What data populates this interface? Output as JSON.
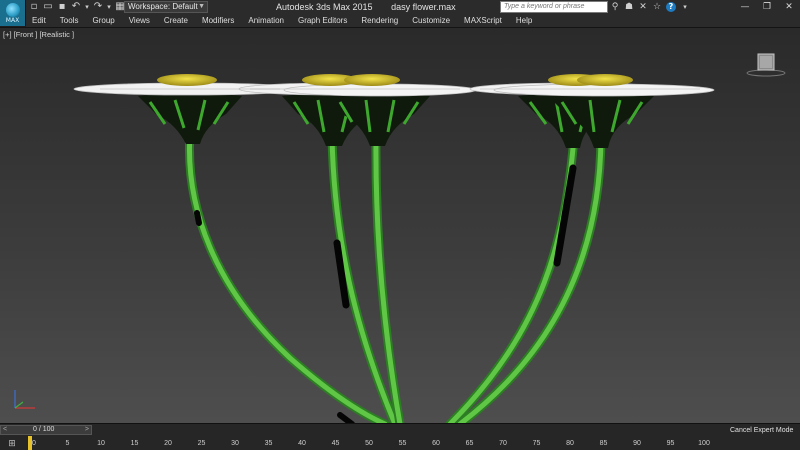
{
  "app": {
    "logo_text": "MAX",
    "title": "Autodesk 3ds Max  2015",
    "file_name": "dasy flower.max"
  },
  "quick_access": {
    "icons": [
      "new-file-icon",
      "open-file-icon",
      "save-icon",
      "undo-icon",
      "redo-icon",
      "project-folder-icon"
    ]
  },
  "workspace": {
    "selected": "Workspace: Default"
  },
  "search": {
    "placeholder": "Type a keyword or phrase"
  },
  "info_center": {
    "icons": [
      "search-binoculars-icon",
      "user-signin-icon",
      "exchange-icon",
      "favorites-star-icon",
      "help-icon"
    ],
    "help_glyph": "?"
  },
  "menu": {
    "items": [
      "Edit",
      "Tools",
      "Group",
      "Views",
      "Create",
      "Modifiers",
      "Animation",
      "Graph Editors",
      "Rendering",
      "Customize",
      "MAXScript",
      "Help"
    ]
  },
  "viewport": {
    "label": "[+] [Front ] [Realistic ]"
  },
  "timeline": {
    "frame_label": "0 / 100",
    "ticks": [
      "0",
      "5",
      "10",
      "15",
      "20",
      "25",
      "30",
      "35",
      "40",
      "45",
      "50",
      "55",
      "60",
      "65",
      "70",
      "75",
      "80",
      "85",
      "90",
      "95",
      "100"
    ],
    "current_frame": 0,
    "status_button": "Cancel Expert Mode"
  },
  "colors": {
    "petal": "#f2f2f2",
    "center": "#d9c42c",
    "stem": "#4dbb3a",
    "stem_dark": "#2d7d24"
  }
}
